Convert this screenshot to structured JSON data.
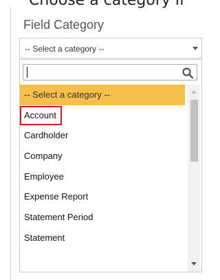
{
  "header_cut_text": "Choose a category if",
  "field": {
    "label": "Field Category",
    "select_value": "-- Select a category --"
  },
  "search": {
    "value": ""
  },
  "options": [
    "-- Select a category --",
    "Account",
    "Cardholder",
    "Company",
    "Employee",
    "Expense Report",
    "Statement Period",
    "Statement"
  ],
  "colors": {
    "selected": "#f6bf4b",
    "highlight_border": "#d01c1c"
  }
}
